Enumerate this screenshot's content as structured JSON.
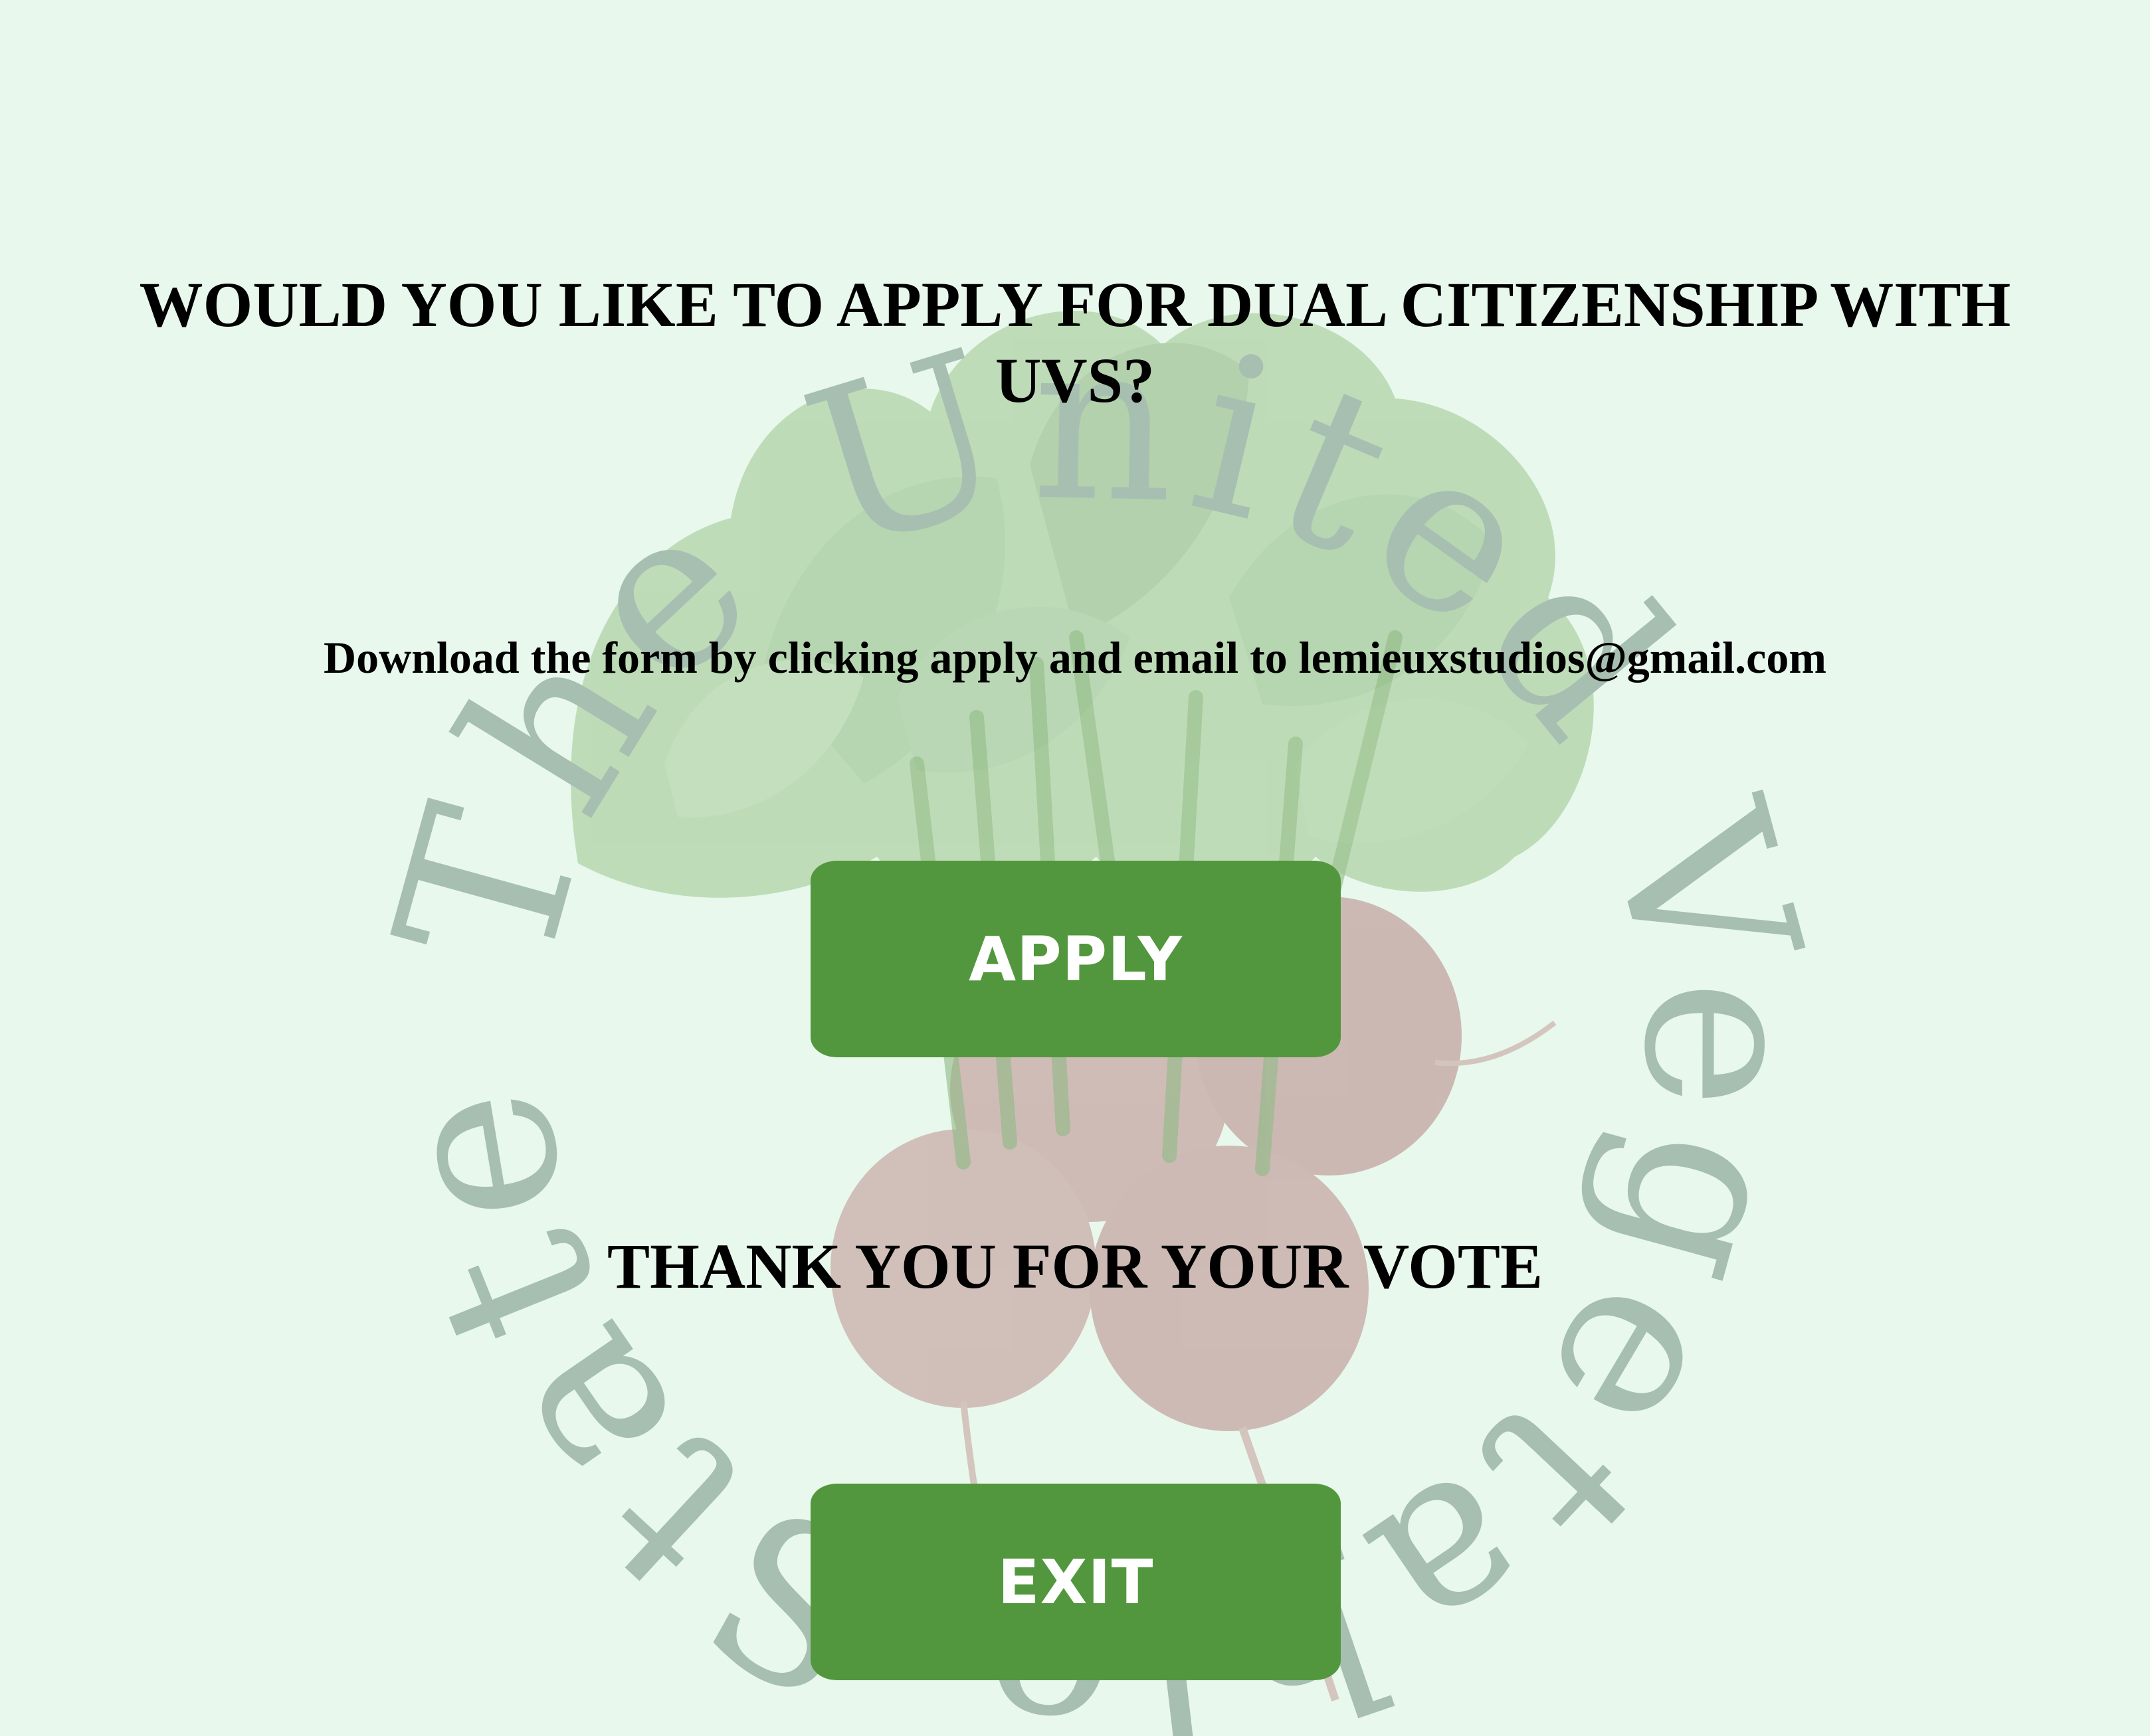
{
  "page": {
    "question": "WOULD YOU LIKE TO APPLY FOR DUAL CITIZENSHIP WITH UVS?",
    "instructions": "Download the form by clicking apply and email to lemieuxstudios@gmail.com",
    "apply_label": "APPLY",
    "thanks": "THANK YOU FOR YOUR VOTE",
    "exit_label": "EXIT"
  },
  "watermark": {
    "text": "The United Vegetable States",
    "color": "#a7bfb1"
  },
  "colors": {
    "background": "#e8f8ec",
    "button": "#52973d",
    "button_text": "#ffffff",
    "heading_text": "#000000",
    "leaf": "#9dc48f",
    "beet": "#b98b8b"
  },
  "icons": {
    "background_art": "radish-bunch-icon"
  }
}
